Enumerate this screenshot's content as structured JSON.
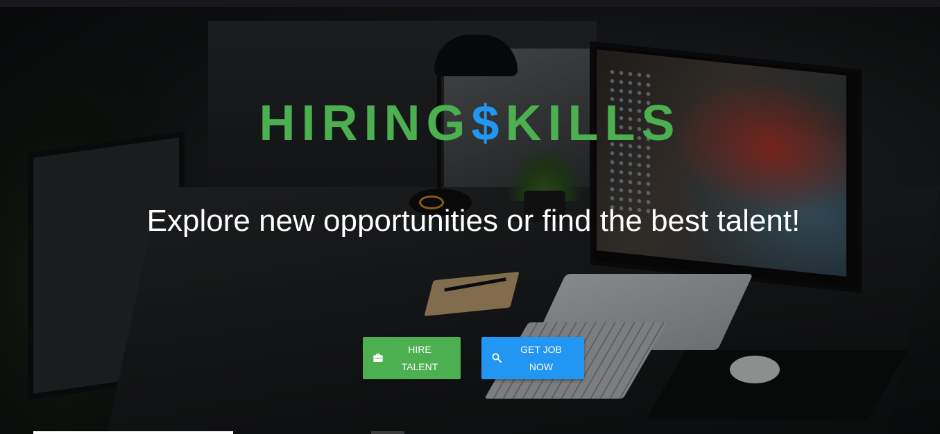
{
  "hero": {
    "brand": {
      "part1": "HIRING",
      "dollar": "$",
      "part2": "KILLS",
      "primary_color": "#4caf50",
      "accent_color": "#2196f3"
    },
    "tagline": "Explore new opportunities or find the best talent!",
    "buttons": {
      "hire": {
        "label": "HIRE\nTALENT",
        "icon": "briefcase-icon",
        "color": "#4caf50"
      },
      "job": {
        "label": "GET JOB\nNOW",
        "icon": "search-icon",
        "color": "#2196f3"
      }
    }
  }
}
